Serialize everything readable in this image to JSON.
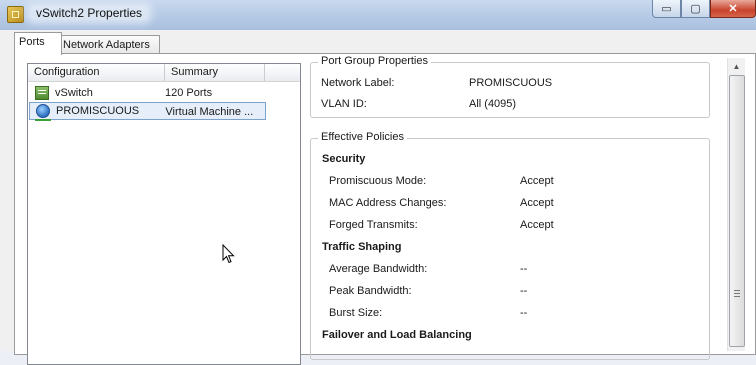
{
  "window": {
    "title": "vSwitch2 Properties",
    "minimize_glyph": "▭",
    "maximize_glyph": "▢",
    "close_glyph": "✕"
  },
  "tabs": [
    {
      "label": "Ports",
      "active": true
    },
    {
      "label": "Network Adapters",
      "active": false
    }
  ],
  "list": {
    "columns": [
      "Configuration",
      "Summary"
    ],
    "rows": [
      {
        "icon": "vswitch-icon",
        "configuration": "vSwitch",
        "summary": "120 Ports",
        "selected": false
      },
      {
        "icon": "port-group-icon",
        "configuration": "PROMISCUOUS",
        "summary": "Virtual Machine ...",
        "selected": true
      }
    ]
  },
  "port_group_properties": {
    "legend": "Port Group Properties",
    "network_label_key": "Network Label:",
    "network_label_value": "PROMISCUOUS",
    "vlan_key": "VLAN ID:",
    "vlan_value": "All (4095)"
  },
  "effective_policies": {
    "legend": "Effective Policies",
    "security": {
      "heading": "Security",
      "promiscuous_key": "Promiscuous Mode:",
      "promiscuous_value": "Accept",
      "mac_key": "MAC Address Changes:",
      "mac_value": "Accept",
      "forged_key": "Forged Transmits:",
      "forged_value": "Accept"
    },
    "traffic_shaping": {
      "heading": "Traffic Shaping",
      "avg_key": "Average Bandwidth:",
      "avg_value": "--",
      "peak_key": "Peak Bandwidth:",
      "peak_value": "--",
      "burst_key": "Burst Size:",
      "burst_value": "--"
    },
    "failover_heading": "Failover and Load Balancing"
  },
  "scrollbar": {
    "up_glyph": "▲"
  }
}
